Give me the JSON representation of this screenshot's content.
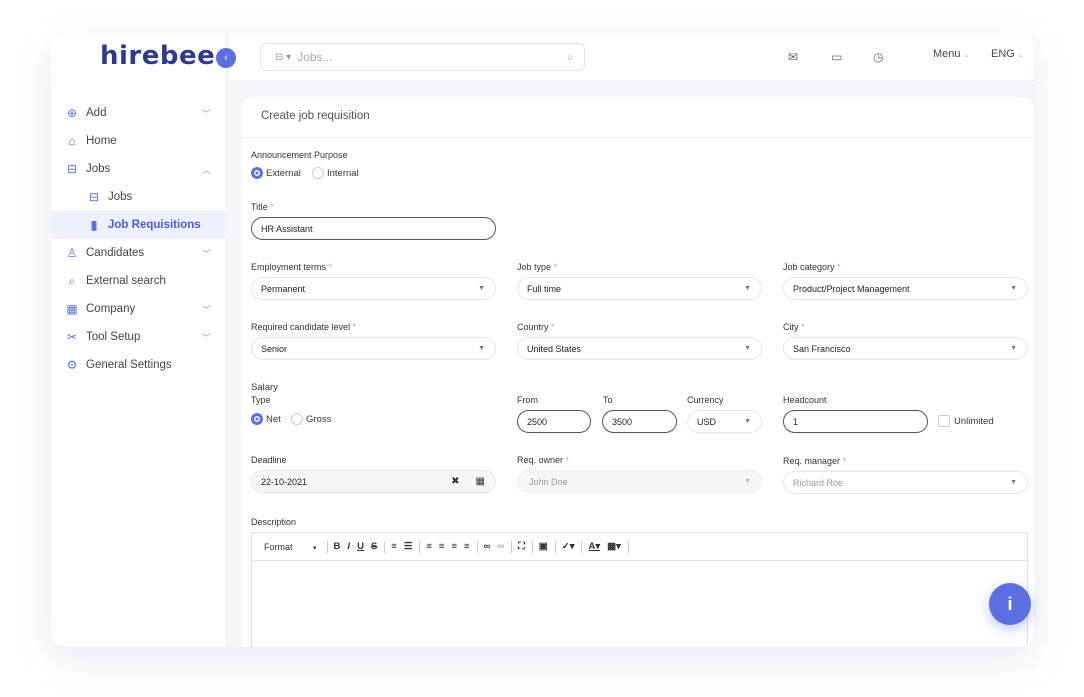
{
  "logo": "hirebee",
  "sidebar": {
    "items": [
      {
        "label": "Add",
        "icon": "plus-circle-icon"
      },
      {
        "label": "Home",
        "icon": "home-icon"
      },
      {
        "label": "Jobs",
        "icon": "briefcase-icon"
      },
      {
        "label": "Jobs",
        "icon": "briefcase-icon"
      },
      {
        "label": "Job Requisitions",
        "icon": "clipboard-icon"
      },
      {
        "label": "Candidates",
        "icon": "user-icon"
      },
      {
        "label": "External search",
        "icon": "search-icon"
      },
      {
        "label": "Company",
        "icon": "building-icon"
      },
      {
        "label": "Tool Setup",
        "icon": "tools-icon"
      },
      {
        "label": "General Settings",
        "icon": "gear-icon"
      }
    ]
  },
  "topbar": {
    "search_placeholder": "Jobs...",
    "menu_label": "Menu",
    "lang_label": "ENG"
  },
  "form": {
    "title": "Create job requisition",
    "announcement": {
      "label": "Announcement Purpose",
      "options": [
        "External",
        "Internal"
      ],
      "selected": "External"
    },
    "title_field": {
      "label": "Title",
      "value": "HR Assistant"
    },
    "employment_terms": {
      "label": "Employment terms",
      "value": "Permanent"
    },
    "job_type": {
      "label": "Job type",
      "value": "Full time"
    },
    "job_category": {
      "label": "Job category",
      "value": "Product/Project Management"
    },
    "candidate_level": {
      "label": "Required candidate level",
      "value": "Senior"
    },
    "country": {
      "label": "Country",
      "value": "United States"
    },
    "city": {
      "label": "City",
      "value": "San Francisco"
    },
    "salary": {
      "label": "Salary",
      "type_label": "Type",
      "type_options": [
        "Net",
        "Gross"
      ],
      "type_selected": "Net",
      "from_label": "From",
      "from_value": "2500",
      "to_label": "To",
      "to_value": "3500",
      "currency_label": "Currency",
      "currency_value": "USD"
    },
    "headcount": {
      "label": "Headcount",
      "value": "1",
      "unlimited_label": "Unlimited"
    },
    "deadline": {
      "label": "Deadline",
      "value": "22-10-2021"
    },
    "req_owner": {
      "label": "Req. owner",
      "value": "John Doe"
    },
    "req_manager": {
      "label": "Req. manager",
      "value": "Richard Roe"
    },
    "description": {
      "label": "Description",
      "format_label": "Format"
    }
  },
  "colors": {
    "accent": "#5b6fe0",
    "brand": "#2f3a8f"
  }
}
